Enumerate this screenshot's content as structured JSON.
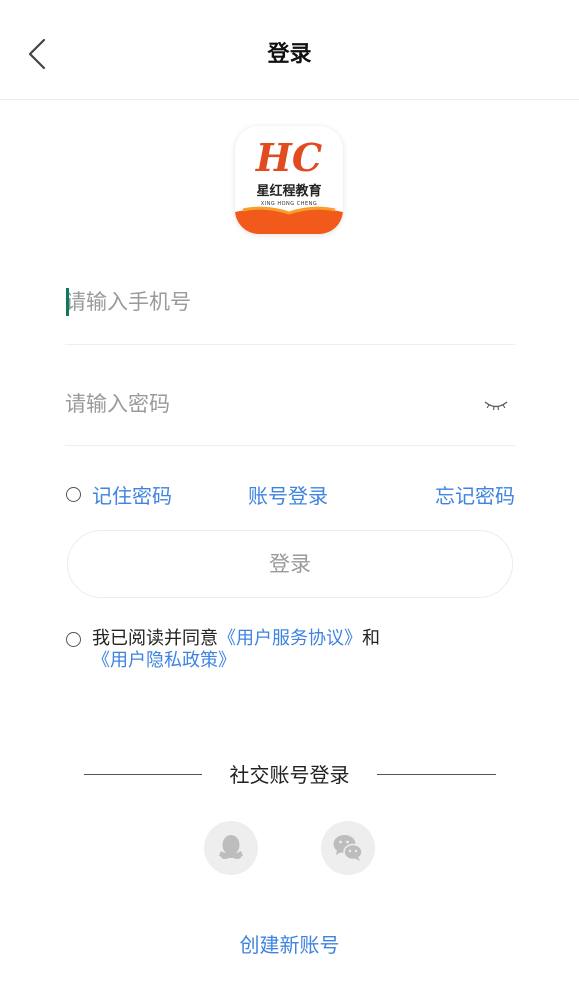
{
  "header": {
    "title": "登录",
    "back_icon": "chevron-left-icon"
  },
  "logo": {
    "monogram": "HC",
    "name_cn": "星红程教育",
    "name_en": "XING HONG CHENG",
    "colors": {
      "primary": "#e24a1f",
      "accent": "#f6a02b"
    }
  },
  "form": {
    "phone_placeholder": "请输入手机号",
    "phone_value": "",
    "password_placeholder": "请输入密码",
    "password_value": "",
    "eye_icon": "eye-closed-icon"
  },
  "options": {
    "remember_label": "记住密码",
    "account_login_label": "账号登录",
    "forgot_label": "忘记密码"
  },
  "login_button": "登录",
  "agreement": {
    "prefix": "我已阅读并同意",
    "service_link": "《用户服务协议》",
    "conjunction": "和",
    "privacy_link": "《用户隐私政策》"
  },
  "social": {
    "label": "社交账号登录",
    "qq_icon": "qq-penguin-icon",
    "wechat_icon": "wechat-icon"
  },
  "create_account": "创建新账号",
  "colors": {
    "link": "#3f83e0",
    "placeholder": "#9a9a9a",
    "caret": "#0b7a5c",
    "divider": "#eeeeee"
  }
}
